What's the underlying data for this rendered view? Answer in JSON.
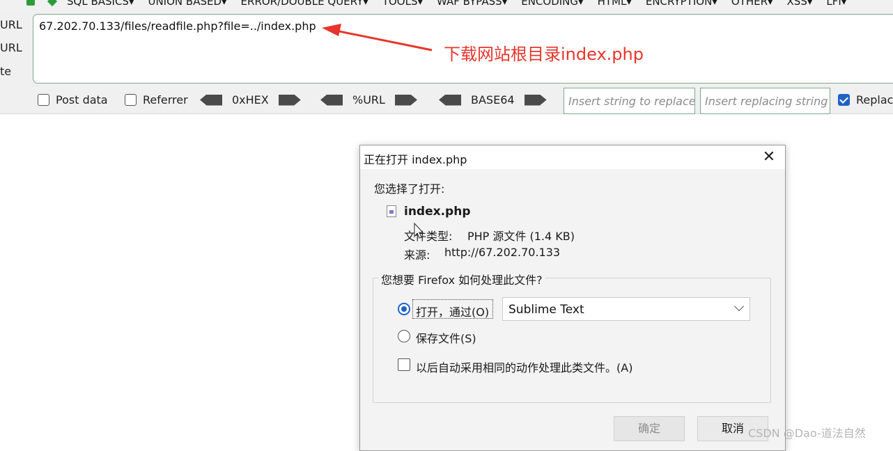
{
  "menu": {
    "items": [
      "SQL BASICS▾",
      "UNION BASED▾",
      "ERROR/DOUBLE QUERY▾",
      "TOOLS▾",
      "WAF BYPASS▾",
      "ENCODING▾",
      "HTML▾",
      "ENCRYPTION▾",
      "OTHER▾",
      "XSS▾",
      "LFI▾"
    ]
  },
  "side_labels": [
    "URL",
    "URL",
    "te"
  ],
  "url": {
    "value": "67.202.70.133/files/readfile.php?file=../index.php"
  },
  "annotation": {
    "text": "下载网站根目录index.php",
    "color": "#e8352b"
  },
  "options": {
    "post_data": "Post data",
    "referrer": "Referrer",
    "hex": "0xHEX",
    "url_enc": "%URL",
    "base64": "BASE64",
    "insert_placeholder": "Insert string to replace",
    "replacing_placeholder": "Insert replacing string",
    "replace_label": "Replac"
  },
  "dialog": {
    "title": "正在打开 index.php",
    "chosen_label": "您选择了打开:",
    "filename": "index.php",
    "file_type_label": "文件类型:",
    "file_type_value": "PHP 源文件 (1.4 KB)",
    "source_label": "来源:",
    "source_value": "http://67.202.70.133",
    "question": "您想要 Firefox 如何处理此文件?",
    "open_with_label": "打开，通过(O)",
    "app_selected": "Sublime Text",
    "save_label": "保存文件(S)",
    "auto_label": "以后自动采用相同的动作处理此类文件。(A)",
    "ok_button": "确定",
    "cancel_button": "取消"
  },
  "watermark": "CSDN @Dao-道法自然",
  "colors": {
    "accent_blue": "#1f62c6",
    "field_border_green": "#7fa98a",
    "annotation_red": "#e8352b"
  }
}
